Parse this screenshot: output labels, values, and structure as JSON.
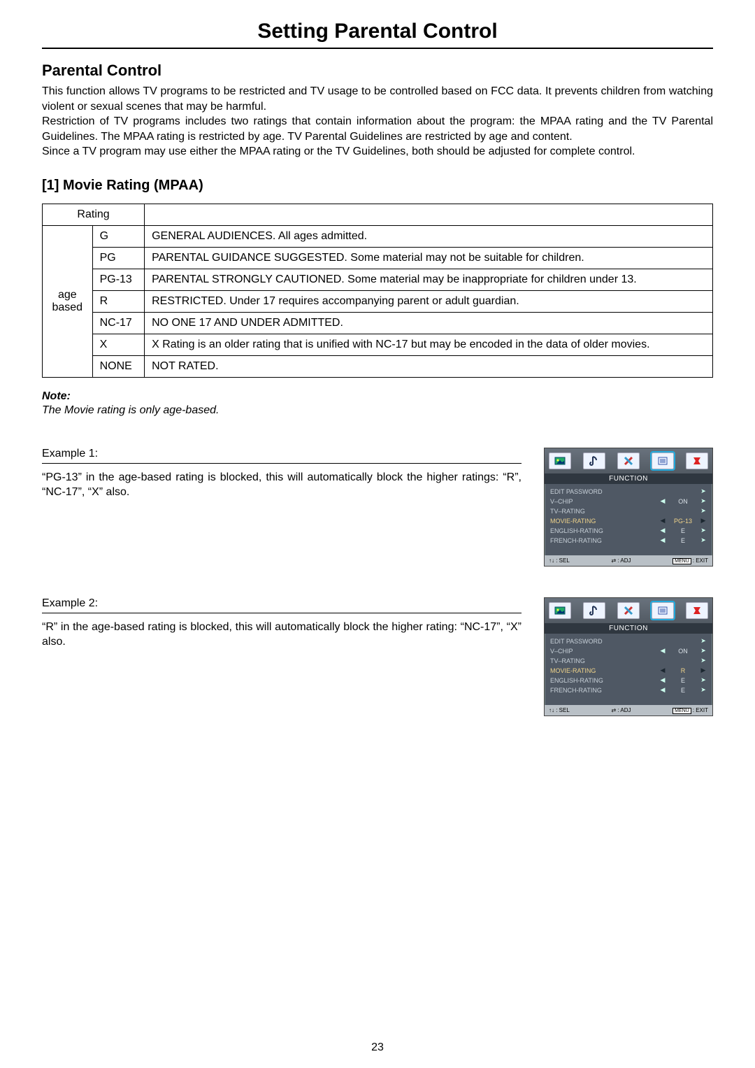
{
  "title": "Setting Parental Control",
  "subhead": "Parental Control",
  "intro_paragraphs": [
    "This function allows TV programs to be restricted and TV usage to be controlled based on FCC data. It prevents children from watching violent or sexual scenes that may be harmful.",
    "Restriction of TV programs includes two ratings that contain information about the program: the MPAA rating and the TV Parental Guidelines. The MPAA rating is restricted by age. TV Parental Guidelines are restricted by age and content.",
    "Since a TV program may use either the MPAA rating or the TV Guidelines, both should be adjusted for complete control."
  ],
  "section1_head": "[1] Movie Rating (MPAA)",
  "table": {
    "rating_header": "Rating",
    "group_label_line1": "age",
    "group_label_line2": "based",
    "rows": [
      {
        "code": "G",
        "desc": "GENERAL AUDIENCES. All ages admitted."
      },
      {
        "code": "PG",
        "desc": "PARENTAL GUIDANCE SUGGESTED. Some material may not be suitable for children."
      },
      {
        "code": "PG-13",
        "desc": "PARENTAL STRONGLY CAUTIONED. Some material may be inappropriate for children under 13."
      },
      {
        "code": "R",
        "desc": "RESTRICTED. Under 17 requires accompanying parent or adult guardian."
      },
      {
        "code": "NC-17",
        "desc": "NO ONE 17 AND UNDER ADMITTED."
      },
      {
        "code": "X",
        "desc": "X Rating is an older rating that is unified with NC-17 but may be encoded in the data of older movies."
      },
      {
        "code": "NONE",
        "desc": "NOT RATED."
      }
    ]
  },
  "note_label": "Note:",
  "note_body": "The Movie rating is only age-based.",
  "examples": [
    {
      "title": "Example 1:",
      "body": "“PG-13” in the age-based rating is blocked, this will automatically block the higher ratings: “R”, “NC-17”, “X” also.",
      "osd": {
        "title": "FUNCTION",
        "rows": [
          {
            "label": "EDIT PASSWORD",
            "val": "",
            "hl": false,
            "arrows": "right"
          },
          {
            "label": "V–CHIP",
            "val": "ON",
            "hl": false,
            "arrows": "both"
          },
          {
            "label": "TV–RATING",
            "val": "",
            "hl": false,
            "arrows": "right"
          },
          {
            "label": "MOVIE-RATING",
            "val": "PG-13",
            "hl": true,
            "arrows": "bold"
          },
          {
            "label": "ENGLISH-RATING",
            "val": "E",
            "hl": false,
            "arrows": "both"
          },
          {
            "label": "FRENCH-RATING",
            "val": "E",
            "hl": false,
            "arrows": "both"
          }
        ],
        "foot_sel": ": SEL",
        "foot_adj": ": ADJ",
        "foot_menu": "MENU",
        "foot_exit": ": EXIT"
      }
    },
    {
      "title": "Example 2:",
      "body": "“R” in the age-based rating is blocked, this will automatically block the higher rating: “NC-17”, “X” also.",
      "osd": {
        "title": "FUNCTION",
        "rows": [
          {
            "label": "EDIT PASSWORD",
            "val": "",
            "hl": false,
            "arrows": "right"
          },
          {
            "label": "V–CHIP",
            "val": "ON",
            "hl": false,
            "arrows": "both"
          },
          {
            "label": "TV–RATING",
            "val": "",
            "hl": false,
            "arrows": "right"
          },
          {
            "label": "MOVIE-RATING",
            "val": "R",
            "hl": true,
            "arrows": "bold"
          },
          {
            "label": "ENGLISH-RATING",
            "val": "E",
            "hl": false,
            "arrows": "both"
          },
          {
            "label": "FRENCH-RATING",
            "val": "E",
            "hl": false,
            "arrows": "both"
          }
        ],
        "foot_sel": ": SEL",
        "foot_adj": ": ADJ",
        "foot_menu": "MENU",
        "foot_exit": ": EXIT"
      }
    }
  ],
  "arrows": {
    "updown": "↑↓",
    "leftright": "⇄"
  },
  "page_number": "23"
}
